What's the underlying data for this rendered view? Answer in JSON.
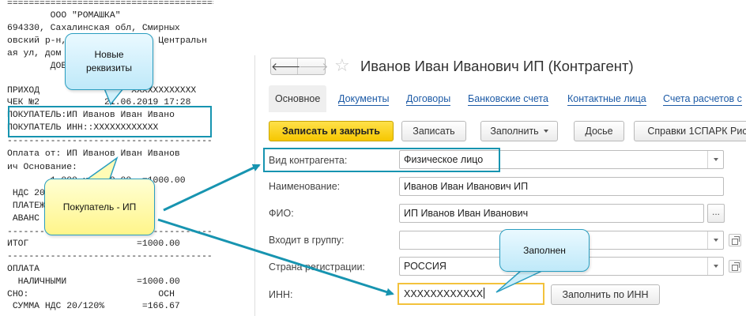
{
  "receipt": {
    "lines": [
      "==========================================",
      "        ООО \"РОМАШКА\"",
      "694330, Сахалинская обл, Смирных",
      "овский р-н, пгт Смирных, ул Центральн",
      "ая ул, дом № 4",
      "        ДОБРО ПОЖАЛОВАТЬ!",
      "",
      "ПРИХОД            ИНН  XXXXXXXXXXXX",
      "ЧЕК №2            21.06.2019 17:28",
      "ПОКУПАТЕЛЬ:ИП Иванов Иван Ивано",
      "ПОКУПАТЕЛЬ ИНН::XXXXXXXXXXXX",
      "------------------------------------------",
      "Оплата от: ИП Иванов Иван Иванов",
      "ич Основание:",
      "        1.000 х 1000.00  =1000.00",
      " НДС 20%",
      " ПЛАТЕЖ",
      " АВАНС",
      "------------------------------------------",
      "ИТОГ                    =1000.00",
      "------------------------------------------",
      "ОПЛАТА",
      "  НАЛИЧНЫМИ             =1000.00",
      "СНО:                        ОСН",
      " СУММА НДС 20/120%       =166.67"
    ]
  },
  "window": {
    "title": "Иванов Иван Иванович ИП (Контрагент)",
    "back_glyph": "🡐",
    "fwd_glyph": "🡒",
    "star_glyph": "☆"
  },
  "tabs": [
    "Основное",
    "Документы",
    "Договоры",
    "Банковские счета",
    "Контактные лица",
    "Счета расчетов с"
  ],
  "toolbar": {
    "save_close": "Записать и закрыть",
    "save": "Записать",
    "fill": "Заполнить",
    "dossier": "Досье",
    "spark": "Справки 1СПАРК Рис"
  },
  "form": {
    "kind_label": "Вид контрагента:",
    "kind_value": "Физическое лицо",
    "name_label": "Наименование:",
    "name_value": "Иванов Иван Иванович ИП",
    "fio_label": "ФИО:",
    "fio_value": "ИП Иванов Иван Иванович",
    "group_label": "Входит в группу:",
    "group_value": "",
    "country_label": "Страна регистрации:",
    "country_value": "РОССИЯ",
    "inn_label": "ИНН:",
    "inn_value": "XXXXXXXXXXXX",
    "fill_by_inn": "Заполнить по ИНН",
    "ellipsis": "..."
  },
  "callouts": {
    "new_requisites": "Новые реквизиты",
    "buyer_ip": "Покупатель - ИП",
    "filled": "Заполнен"
  },
  "colors": {
    "highlight": "#1794b0",
    "primary_button": "#f6c700",
    "inn_focus": "#f3c23c",
    "link": "#1c5aa6"
  }
}
